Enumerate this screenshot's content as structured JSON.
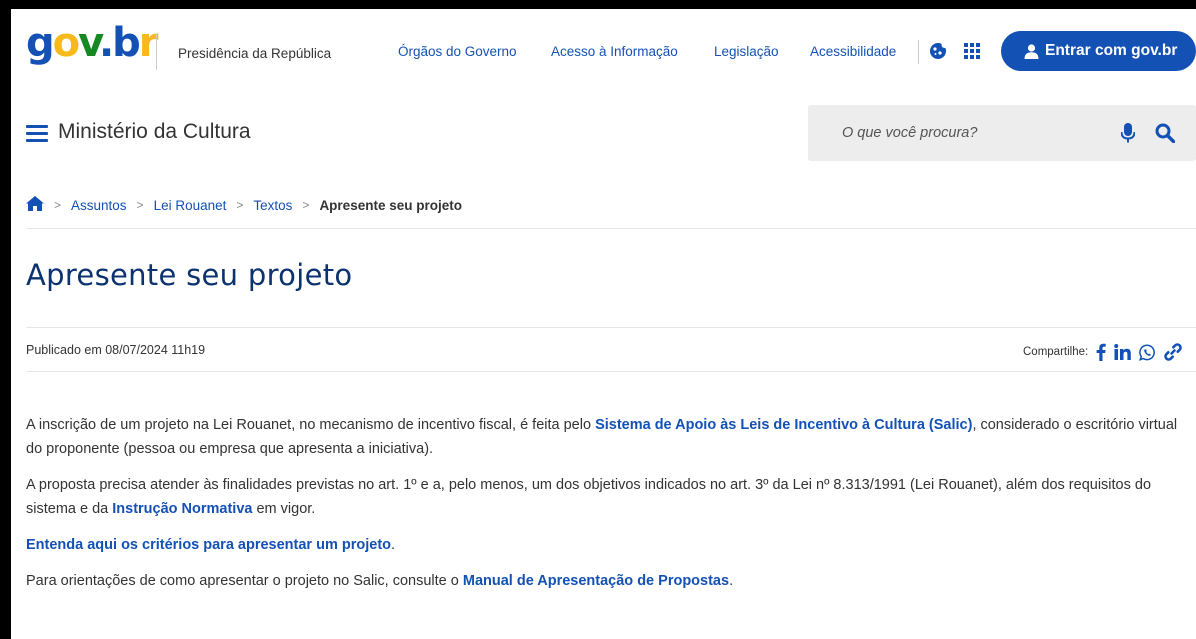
{
  "topbar": {
    "logo": {
      "g": "g",
      "o": "o",
      "v": "v",
      "dot": ".",
      "b": "b",
      "r": "r"
    },
    "presidency": "Presidência da República",
    "links": [
      "Órgãos do Governo",
      "Acesso à Informação",
      "Legislação",
      "Acessibilidade"
    ],
    "login_label": "Entrar com gov.br"
  },
  "header": {
    "ministry": "Ministério da Cultura",
    "search_placeholder": "O que você procura?"
  },
  "breadcrumb": {
    "sep": ">",
    "items": [
      "Assuntos",
      "Lei Rouanet",
      "Textos"
    ],
    "current": "Apresente seu projeto"
  },
  "page": {
    "title": "Apresente seu projeto",
    "published": "Publicado em 08/07/2024 11h19",
    "share_label": "Compartilhe:",
    "share_icons": [
      "facebook-icon",
      "linkedin-icon",
      "whatsapp-icon",
      "link-icon"
    ]
  },
  "content": {
    "p1": {
      "pre": "A inscrição de um projeto na Lei Rouanet, no mecanismo de incentivo fiscal, é feita pelo ",
      "link": "Sistema de Apoio às Leis de Incentivo à Cultura (Salic)",
      "post": ", considerado o escritório virtual do proponente (pessoa ou empresa que apresenta a iniciativa)."
    },
    "p2": {
      "pre": "A proposta precisa atender às finalidades previstas no art. 1º e a, pelo menos, um dos objetivos indicados no art. 3º da Lei nº 8.313/1991 (Lei Rouanet), além dos requisitos do sistema e da ",
      "link": "Instrução Normativa",
      "post": " em vigor."
    },
    "p3": {
      "link": "Entenda aqui os critérios para apresentar um projeto",
      "post": "."
    },
    "p4": {
      "pre": "Para orientações de como apresentar o projeto no Salic, consulte o ",
      "link": "Manual de Apresentação de Propostas",
      "post": "."
    }
  },
  "colors": {
    "primary": "#1351b4",
    "title": "#0c326f",
    "logo_yellow": "#f8b91b",
    "logo_green": "#168821"
  }
}
